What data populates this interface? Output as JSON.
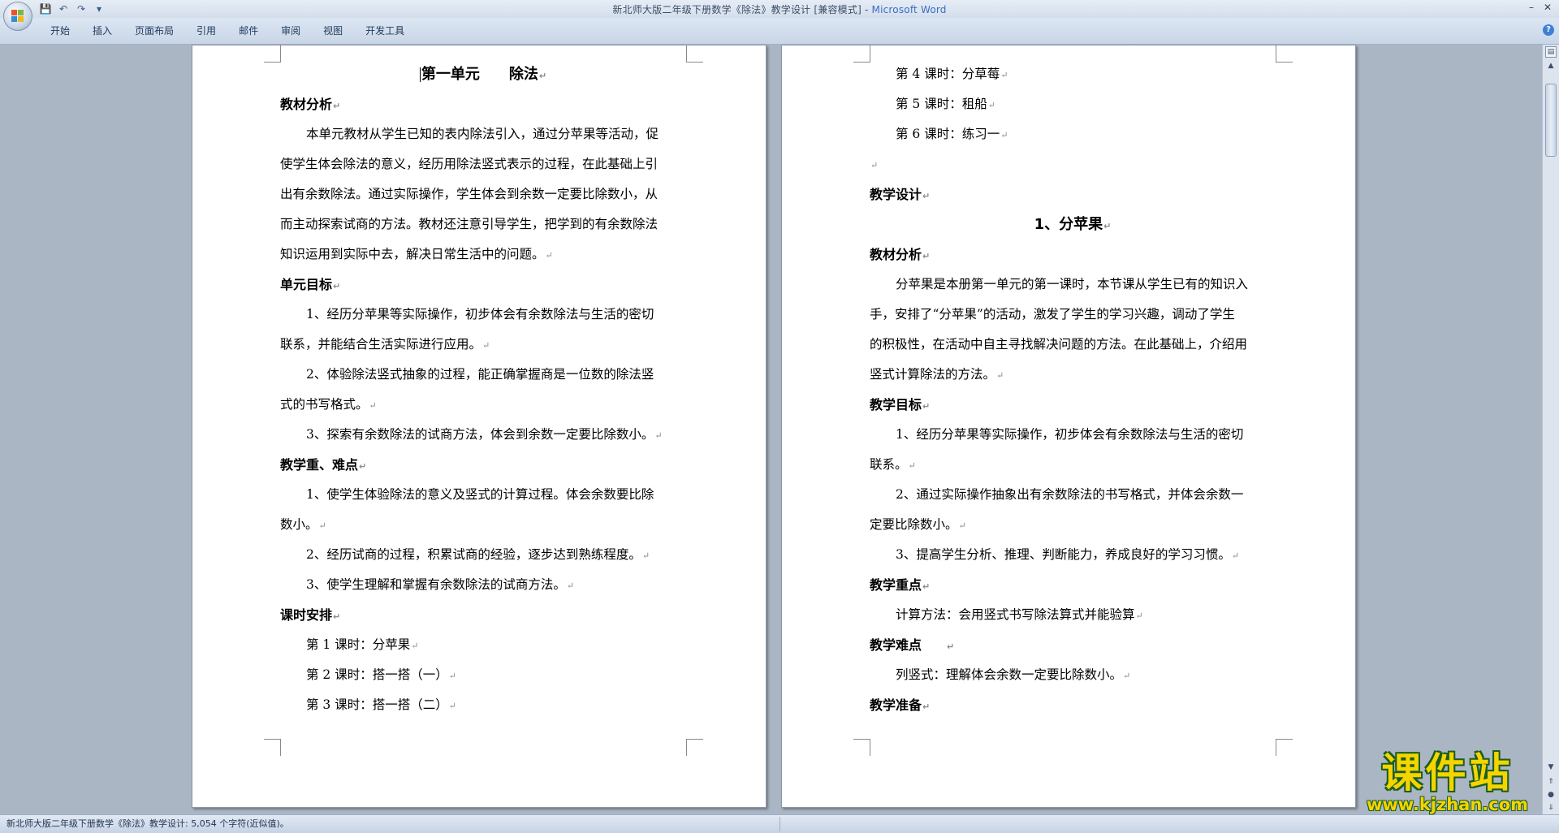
{
  "window": {
    "title_doc": "新北师大版二年级下册数学《除法》教学设计 [兼容模式]",
    "title_sep": " - ",
    "title_app": "Microsoft Word",
    "minimize": "–",
    "close": "✕"
  },
  "qat": {
    "save": "💾",
    "undo": "↶",
    "redo": "↷",
    "customize": "▾"
  },
  "ribbon": {
    "tabs": [
      "开始",
      "插入",
      "页面布局",
      "引用",
      "邮件",
      "审阅",
      "视图",
      "开发工具"
    ],
    "help": "?"
  },
  "page1": {
    "title": "第一单元　　除法",
    "h_analysis": "教材分析",
    "analysis": [
      "本单元教材从学生已知的表内除法引入，通过分苹果等活动，促",
      "使学生体会除法的意义，经历用除法竖式表示的过程，在此基础上引",
      "出有余数除法。通过实际操作，学生体会到余数一定要比除数小，从",
      "而主动探索试商的方法。教材还注意引导学生，把学到的有余数除法",
      "知识运用到实际中去，解决日常生活中的问题。"
    ],
    "h_goals": "单元目标",
    "goals": [
      "1、经历分苹果等实际操作，初步体会有余数除法与生活的密切",
      "联系，并能结合生活实际进行应用。",
      "2、体验除法竖式抽象的过程，能正确掌握商是一位数的除法竖",
      "式的书写格式。",
      "3、探索有余数除法的试商方法，体会到余数一定要比除数小。"
    ],
    "h_key": "教学重、难点",
    "key": [
      "1、使学生体验除法的意义及竖式的计算过程。体会余数要比除",
      "数小。",
      "2、经历试商的过程，积累试商的经验，逐步达到熟练程度。",
      "3、使学生理解和掌握有余数除法的试商方法。"
    ],
    "h_schedule": "课时安排",
    "schedule": [
      "第 1 课时：分苹果",
      "第 2 课时：搭一搭（一）",
      "第 3 课时：搭一搭（二）"
    ]
  },
  "page2": {
    "schedule": [
      "第 4 课时：分草莓",
      "第 5 课时：租船",
      "第 6 课时：练习一"
    ],
    "h_design": "教学设计",
    "lesson_title": "1、分苹果",
    "h_analysis": "教材分析",
    "analysis": [
      "分苹果是本册第一单元的第一课时，本节课从学生已有的知识入",
      "手，安排了“分苹果”的活动，激发了学生的学习兴趣，调动了学生",
      "的积极性，在活动中自主寻找解决问题的方法。在此基础上，介绍用",
      "竖式计算除法的方法。"
    ],
    "h_goals": "教学目标",
    "goals": [
      "1、经历分苹果等实际操作，初步体会有余数除法与生活的密切",
      "联系。",
      "2、通过实际操作抽象出有余数除法的书写格式，并体会余数一",
      "定要比除数小。",
      "3、提高学生分析、推理、判断能力，养成良好的学习习惯。"
    ],
    "h_key": "教学重点",
    "key": "计算方法：会用竖式书写除法算式并能验算",
    "h_difficulty": "教学难点",
    "difficulty": "列竖式：理解体会余数一定要比除数小。",
    "h_prep": "教学准备"
  },
  "status": {
    "text": "新北师大版二年级下册数学《除法》教学设计: 5,054 个字符(近似值)。"
  },
  "watermark": {
    "main": "课件站",
    "url": "www.kjzhan.com"
  }
}
